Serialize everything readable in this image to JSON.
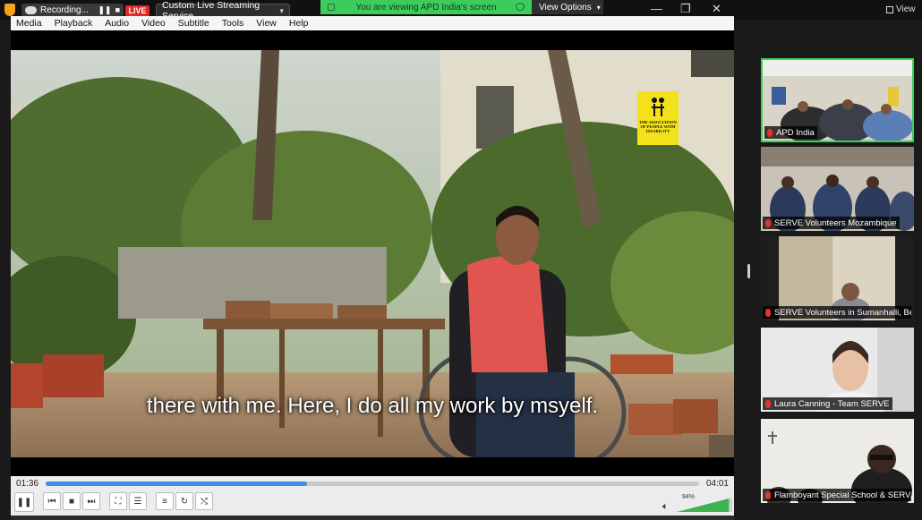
{
  "topbar": {
    "recording_label": "Recording...",
    "recording_pause": "❚❚",
    "recording_stop": "■",
    "live_label": "LIVE",
    "stream_service": "Custom Live Streaming Service",
    "share_banner_text": "You are viewing APD India's screen",
    "view_options_label": "View Options",
    "view_label": "View"
  },
  "menu": {
    "items": [
      "Media",
      "Playback",
      "Audio",
      "Video",
      "Subtitle",
      "Tools",
      "View",
      "Help"
    ]
  },
  "video": {
    "caption": "there with me. Here, I do all my work by msyelf.",
    "logo_text": "THE ASSOCIATION OF PEOPLE WITH DISABILITY"
  },
  "player": {
    "time_current": "01:36",
    "time_total": "04:01",
    "progress": 0.4,
    "volume_percent": "94%"
  },
  "participants": [
    {
      "name": "APD India",
      "active": true
    },
    {
      "name": "SERVE Volunteers Mozambique",
      "active": false
    },
    {
      "name": "SERVE Volunteers in Sumanhalli, Be...",
      "active": false
    },
    {
      "name": "Laura Canning - Team SERVE",
      "active": false
    },
    {
      "name": "Flamboyant Special School & SERV...",
      "active": false
    }
  ],
  "colors": {
    "live_red": "#e02a2a",
    "share_green": "#3dcb5c",
    "active_border": "#38d15a",
    "progress_blue": "#3b8ee0"
  }
}
